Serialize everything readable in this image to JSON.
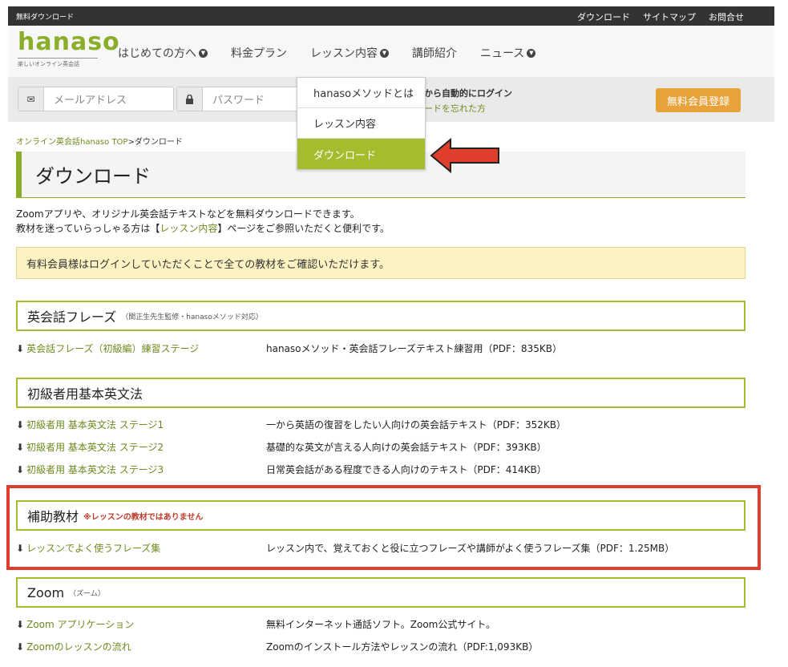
{
  "topbar": {
    "left_label": "無料ダウンロード",
    "links": [
      "ダウンロード",
      "サイトマップ",
      "お問合せ"
    ]
  },
  "logo": {
    "word": "hanaso",
    "tagline": "楽しいオンライン英会話"
  },
  "nav": [
    {
      "label": "はじめての方へ",
      "chevron": true
    },
    {
      "label": "料金プラン",
      "chevron": false
    },
    {
      "label": "レッスン内容",
      "chevron": true
    },
    {
      "label": "講師紹介",
      "chevron": false
    },
    {
      "label": "ニュース",
      "chevron": true
    }
  ],
  "login": {
    "email_placeholder": "メールアドレス",
    "password_placeholder": "パスワード",
    "autologin": "回から自動的にログイン",
    "forgot": "ワードを忘れた方",
    "register": "無料会員登録"
  },
  "dropdown": {
    "items": [
      "hanasoメソッドとは",
      "レッスン内容",
      "ダウンロード"
    ],
    "active_index": 2
  },
  "breadcrumb": {
    "home": "オンライン英会話hanaso TOP",
    "separator": ">",
    "current": "ダウンロード"
  },
  "page": {
    "title": "ダウンロード",
    "intro_line1": "Zoomアプリや、オリジナル英会話テキストなどを無料ダウンロードできます。",
    "intro_line2_pre": "教材を迷っていらっしゃる方は【",
    "intro_line2_link": "レッスン内容",
    "intro_line2_post": "】ページをご参照いただくと便利です。",
    "notice": "有料会員様はログインしていただくことで全ての教材をご確認いただけます。"
  },
  "sections": [
    {
      "title": "英会話フレーズ",
      "sub": "（関正生先生監修・hanasoメソッド対応）",
      "warn": "",
      "items": [
        {
          "link": "英会話フレーズ（初級編）練習ステージ",
          "desc": "hanasoメソッド・英会話フレーズテキスト練習用（PDF：835KB）"
        }
      ]
    },
    {
      "title": "初級者用基本英文法",
      "sub": "",
      "warn": "",
      "items": [
        {
          "link": "初級者用 基本英文法 ステージ1",
          "desc": "一から英語の復習をしたい人向けの英会話テキスト（PDF：352KB）"
        },
        {
          "link": "初級者用 基本英文法 ステージ2",
          "desc": "基礎的な英文が言える人向けの英会話テキスト（PDF：393KB）"
        },
        {
          "link": "初級者用 基本英文法 ステージ3",
          "desc": "日常英会話がある程度できる人向けのテキスト（PDF：414KB）"
        }
      ]
    },
    {
      "title": "補助教材",
      "sub": "",
      "warn": "※レッスンの教材ではありません",
      "items": [
        {
          "link": "レッスンでよく使うフレーズ集",
          "desc": "レッスン内で、覚えておくと役に立つフレーズや講師がよく使うフレーズ集（PDF：1.25MB）"
        }
      ]
    },
    {
      "title": "Zoom",
      "sub": "（ズーム）",
      "warn": "",
      "items": [
        {
          "link": "Zoom アプリケーション",
          "desc": "無料インターネット通話ソフト。Zoom公式サイト。"
        },
        {
          "link": "Zoomのレッスンの流れ",
          "desc": "Zoomのインストール方法やレッスンの流れ（PDF:1,093KB）"
        }
      ]
    }
  ],
  "colors": {
    "brand": "#8bae2a",
    "accent": "#e8a23a",
    "highlight": "#e03e2d"
  }
}
